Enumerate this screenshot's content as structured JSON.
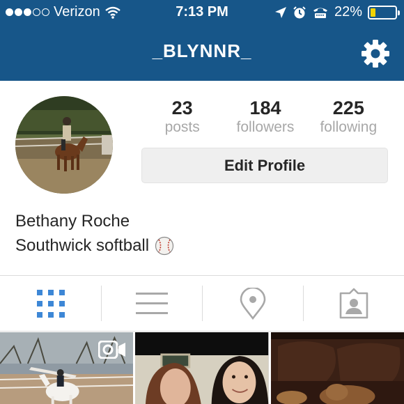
{
  "status_bar": {
    "carrier": "Verizon",
    "time": "7:13 PM",
    "battery_percent": "22%",
    "battery_level": 0.22,
    "signal_bars_filled": 3,
    "signal_bars_total": 5,
    "icons": [
      "wifi-icon",
      "location-arrow-icon",
      "alarm-icon",
      "tty-icon",
      "battery-icon"
    ]
  },
  "header": {
    "username": "_BLYNNR_",
    "settings_icon": "gear-icon"
  },
  "profile": {
    "name": "Bethany Roche",
    "bio": "Southwick softball",
    "bio_emoji": "baseball-icon",
    "edit_button": "Edit Profile",
    "stats": [
      {
        "value": "23",
        "label": "posts"
      },
      {
        "value": "184",
        "label": "followers"
      },
      {
        "value": "225",
        "label": "following"
      }
    ]
  },
  "tabs": [
    {
      "name": "grid-view",
      "icon": "grid-icon",
      "active": true
    },
    {
      "name": "list-view",
      "icon": "list-icon",
      "active": false
    },
    {
      "name": "map-view",
      "icon": "location-pin-icon",
      "active": false
    },
    {
      "name": "tagged-photos",
      "icon": "tagged-person-icon",
      "active": false
    }
  ],
  "posts": [
    {
      "name": "post-horse-jump",
      "is_video": true
    },
    {
      "name": "post-selfie",
      "is_video": false
    },
    {
      "name": "post-dog-couch",
      "is_video": false
    }
  ],
  "colors": {
    "header_bg": "#175689",
    "active_tab": "#3d87d6",
    "muted_text": "#a8a8a8",
    "button_bg": "#efefef"
  }
}
